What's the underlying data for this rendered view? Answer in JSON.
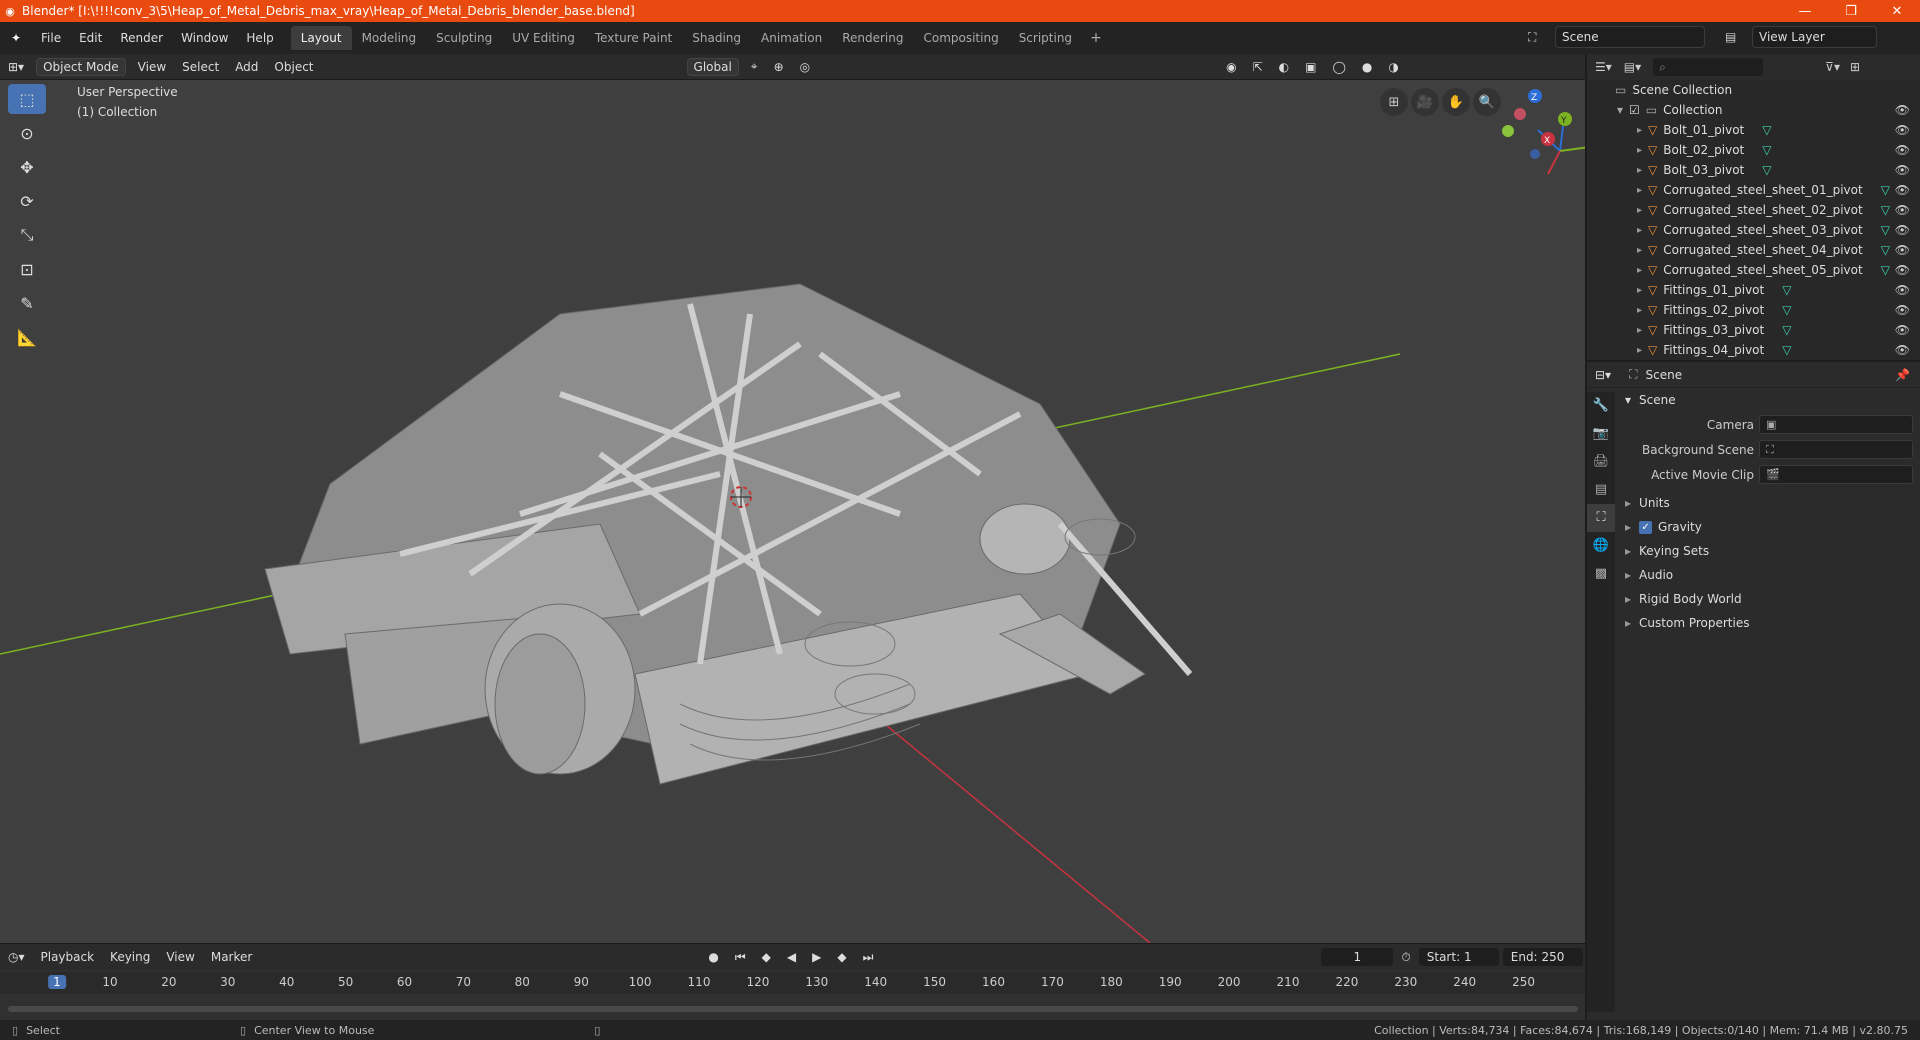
{
  "titlebar": {
    "title": "Blender* [I:\\!!!!conv_3\\5\\Heap_of_Metal_Debris_max_vray\\Heap_of_Metal_Debris_blender_base.blend]",
    "minimize": "—",
    "maximize": "❐",
    "close": "✕"
  },
  "menu": {
    "file": "File",
    "edit": "Edit",
    "render": "Render",
    "window": "Window",
    "help": "Help"
  },
  "workspaces": [
    "Layout",
    "Modeling",
    "Sculpting",
    "UV Editing",
    "Texture Paint",
    "Shading",
    "Animation",
    "Rendering",
    "Compositing",
    "Scripting"
  ],
  "scene_name": "Scene",
  "view_layer": "View Layer",
  "viewport": {
    "mode": "Object Mode",
    "menus": [
      "View",
      "Select",
      "Add",
      "Object"
    ],
    "transform": "Global",
    "perspective": "User Perspective",
    "collection": "(1) Collection"
  },
  "gizmo": {
    "x": "X",
    "y": "Y",
    "z": "Z"
  },
  "timeline": {
    "menus": [
      "Playback",
      "Keying",
      "View",
      "Marker"
    ],
    "current_frame": "1",
    "start_label": "Start:",
    "start": "1",
    "end_label": "End:",
    "end": "250",
    "ruler": [
      "1",
      "10",
      "20",
      "30",
      "40",
      "50",
      "60",
      "70",
      "80",
      "90",
      "100",
      "110",
      "120",
      "130",
      "140",
      "150",
      "160",
      "170",
      "180",
      "190",
      "200",
      "210",
      "220",
      "230",
      "240",
      "250"
    ]
  },
  "status": {
    "left": "Select",
    "middle": "Center View to Mouse",
    "right": "Collection | Verts:84,734 | Faces:84,674 | Tris:168,149 | Objects:0/140 | Mem: 71.4 MB | v2.80.75"
  },
  "outliner": {
    "root": "Scene Collection",
    "collection": "Collection",
    "items": [
      "Bolt_01_pivot",
      "Bolt_02_pivot",
      "Bolt_03_pivot",
      "Corrugated_steel_sheet_01_pivot",
      "Corrugated_steel_sheet_02_pivot",
      "Corrugated_steel_sheet_03_pivot",
      "Corrugated_steel_sheet_04_pivot",
      "Corrugated_steel_sheet_05_pivot",
      "Fittings_01_pivot",
      "Fittings_02_pivot",
      "Fittings_03_pivot",
      "Fittings_04_pivot"
    ]
  },
  "properties": {
    "context": "Scene",
    "section": "Scene",
    "camera_label": "Camera",
    "background_label": "Background Scene",
    "movie_clip_label": "Active Movie Clip",
    "panels": [
      "Units",
      "Gravity",
      "Keying Sets",
      "Audio",
      "Rigid Body World",
      "Custom Properties"
    ]
  },
  "colors": {
    "titlebar": "#e84a0f",
    "accent": "#4772b3",
    "axis_x": "#c8333f",
    "axis_y": "#7cb320",
    "mesh_icon": "#3dd2ae",
    "object_icon": "#e8913b"
  }
}
